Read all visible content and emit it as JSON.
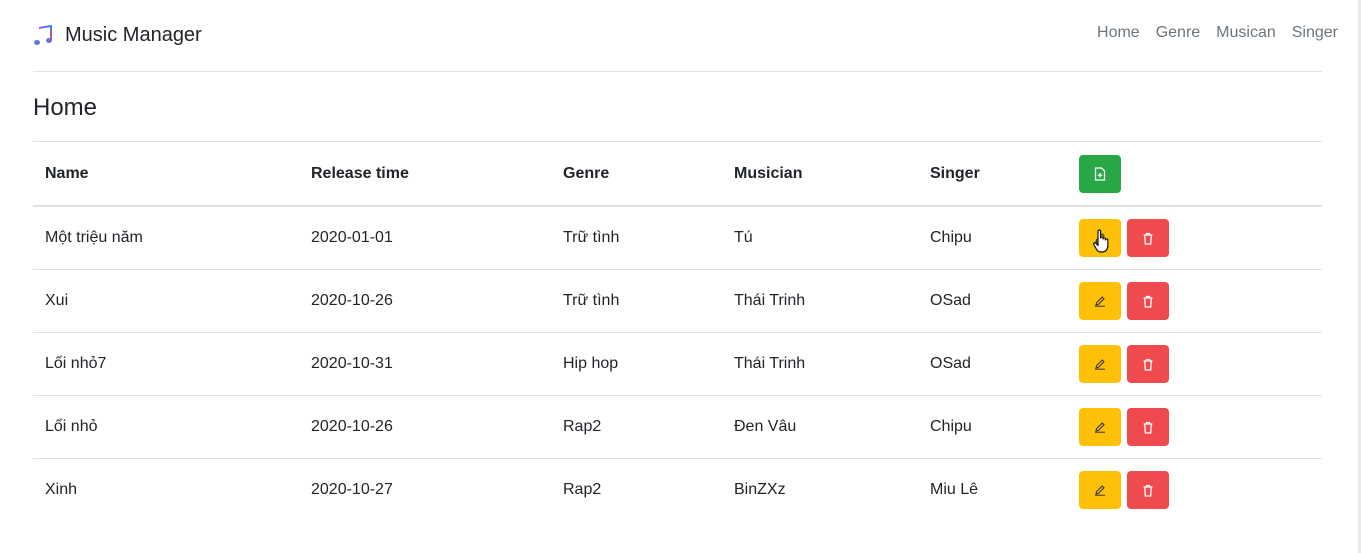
{
  "brand": {
    "title": "Music Manager",
    "icon": "music-note-icon",
    "icon_color": "#3b82f6"
  },
  "nav": {
    "items": [
      "Home",
      "Genre",
      "Musican",
      "Singer"
    ]
  },
  "page": {
    "title": "Home"
  },
  "table": {
    "headers": [
      "Name",
      "Release time",
      "Genre",
      "Musician",
      "Singer"
    ],
    "rows": [
      {
        "name": "Một triệu năm",
        "release": "2020-01-01",
        "genre": "Trữ tình",
        "musician": "Tú",
        "singer": "Chipu"
      },
      {
        "name": "Xui",
        "release": "2020-10-26",
        "genre": "Trữ tình",
        "musician": "Thái Trinh",
        "singer": "OSad"
      },
      {
        "name": "Lối nhỏ7",
        "release": "2020-10-31",
        "genre": "Hip hop",
        "musician": "Thái Trinh",
        "singer": "OSad"
      },
      {
        "name": "Lối nhỏ",
        "release": "2020-10-26",
        "genre": "Rap2",
        "musician": "Đen Vâu",
        "singer": "Chipu"
      },
      {
        "name": "Xinh",
        "release": "2020-10-27",
        "genre": "Rap2",
        "musician": "BinZXz",
        "singer": "Miu Lê"
      }
    ]
  },
  "colors": {
    "add": "#28a745",
    "edit": "#ffc107",
    "delete": "#ef4b4f"
  },
  "icons": {
    "add": "file-plus-icon",
    "edit": "pencil-icon",
    "delete": "trash-icon",
    "cursor": "hand-pointer-icon"
  }
}
